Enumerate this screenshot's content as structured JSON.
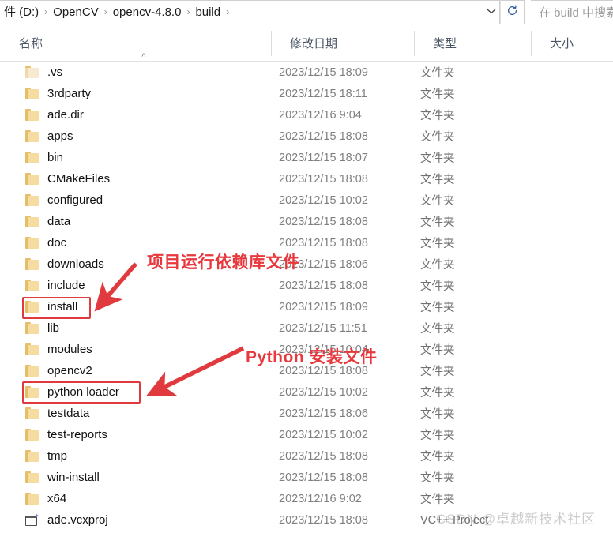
{
  "addressbar": {
    "crumbs": [
      "件 (D:)",
      "OpenCV",
      "opencv-4.8.0",
      "build"
    ],
    "separator": "›",
    "dropdown_icon": "chevron-down-icon",
    "refresh_icon": "refresh-icon",
    "search_placeholder": "在 build 中搜索"
  },
  "columns": {
    "name": "名称",
    "date_modified": "修改日期",
    "type": "类型",
    "size": "大小",
    "sort_indicator": "^"
  },
  "rows": [
    {
      "name": ".vs",
      "date": "2023/12/15 18:09",
      "type": "文件夹",
      "size": "",
      "icon": "folder-icon-hidden"
    },
    {
      "name": "3rdparty",
      "date": "2023/12/15 18:11",
      "type": "文件夹",
      "size": "",
      "icon": "folder-icon"
    },
    {
      "name": "ade.dir",
      "date": "2023/12/16 9:04",
      "type": "文件夹",
      "size": "",
      "icon": "folder-icon"
    },
    {
      "name": "apps",
      "date": "2023/12/15 18:08",
      "type": "文件夹",
      "size": "",
      "icon": "folder-icon"
    },
    {
      "name": "bin",
      "date": "2023/12/15 18:07",
      "type": "文件夹",
      "size": "",
      "icon": "folder-icon"
    },
    {
      "name": "CMakeFiles",
      "date": "2023/12/15 18:08",
      "type": "文件夹",
      "size": "",
      "icon": "folder-icon"
    },
    {
      "name": "configured",
      "date": "2023/12/15 10:02",
      "type": "文件夹",
      "size": "",
      "icon": "folder-icon"
    },
    {
      "name": "data",
      "date": "2023/12/15 18:08",
      "type": "文件夹",
      "size": "",
      "icon": "folder-icon"
    },
    {
      "name": "doc",
      "date": "2023/12/15 18:08",
      "type": "文件夹",
      "size": "",
      "icon": "folder-icon"
    },
    {
      "name": "downloads",
      "date": "2023/12/15 18:06",
      "type": "文件夹",
      "size": "",
      "icon": "folder-icon"
    },
    {
      "name": "include",
      "date": "2023/12/15 18:08",
      "type": "文件夹",
      "size": "",
      "icon": "folder-icon"
    },
    {
      "name": "install",
      "date": "2023/12/15 18:09",
      "type": "文件夹",
      "size": "",
      "icon": "folder-icon"
    },
    {
      "name": "lib",
      "date": "2023/12/15 11:51",
      "type": "文件夹",
      "size": "",
      "icon": "folder-icon"
    },
    {
      "name": "modules",
      "date": "2023/12/15 10:04",
      "type": "文件夹",
      "size": "",
      "icon": "folder-icon"
    },
    {
      "name": "opencv2",
      "date": "2023/12/15 18:08",
      "type": "文件夹",
      "size": "",
      "icon": "folder-icon"
    },
    {
      "name": "python loader",
      "date": "2023/12/15 10:02",
      "type": "文件夹",
      "size": "",
      "icon": "folder-icon"
    },
    {
      "name": "testdata",
      "date": "2023/12/15 18:06",
      "type": "文件夹",
      "size": "",
      "icon": "folder-icon"
    },
    {
      "name": "test-reports",
      "date": "2023/12/15 10:02",
      "type": "文件夹",
      "size": "",
      "icon": "folder-icon"
    },
    {
      "name": "tmp",
      "date": "2023/12/15 18:08",
      "type": "文件夹",
      "size": "",
      "icon": "folder-icon"
    },
    {
      "name": "win-install",
      "date": "2023/12/15 18:08",
      "type": "文件夹",
      "size": "",
      "icon": "folder-icon"
    },
    {
      "name": "x64",
      "date": "2023/12/16 9:02",
      "type": "文件夹",
      "size": "",
      "icon": "folder-icon"
    },
    {
      "name": "ade.vcxproj",
      "date": "2023/12/15 18:08",
      "type": "VC++ Project",
      "size": "",
      "icon": "vcxproj-icon"
    }
  ],
  "annotations": {
    "color": "#e8383d",
    "install_note": "项目运行依赖库文件",
    "python_note": "Python 安装文件"
  },
  "watermark": {
    "text": "CSDN @卓越新技术社区"
  }
}
